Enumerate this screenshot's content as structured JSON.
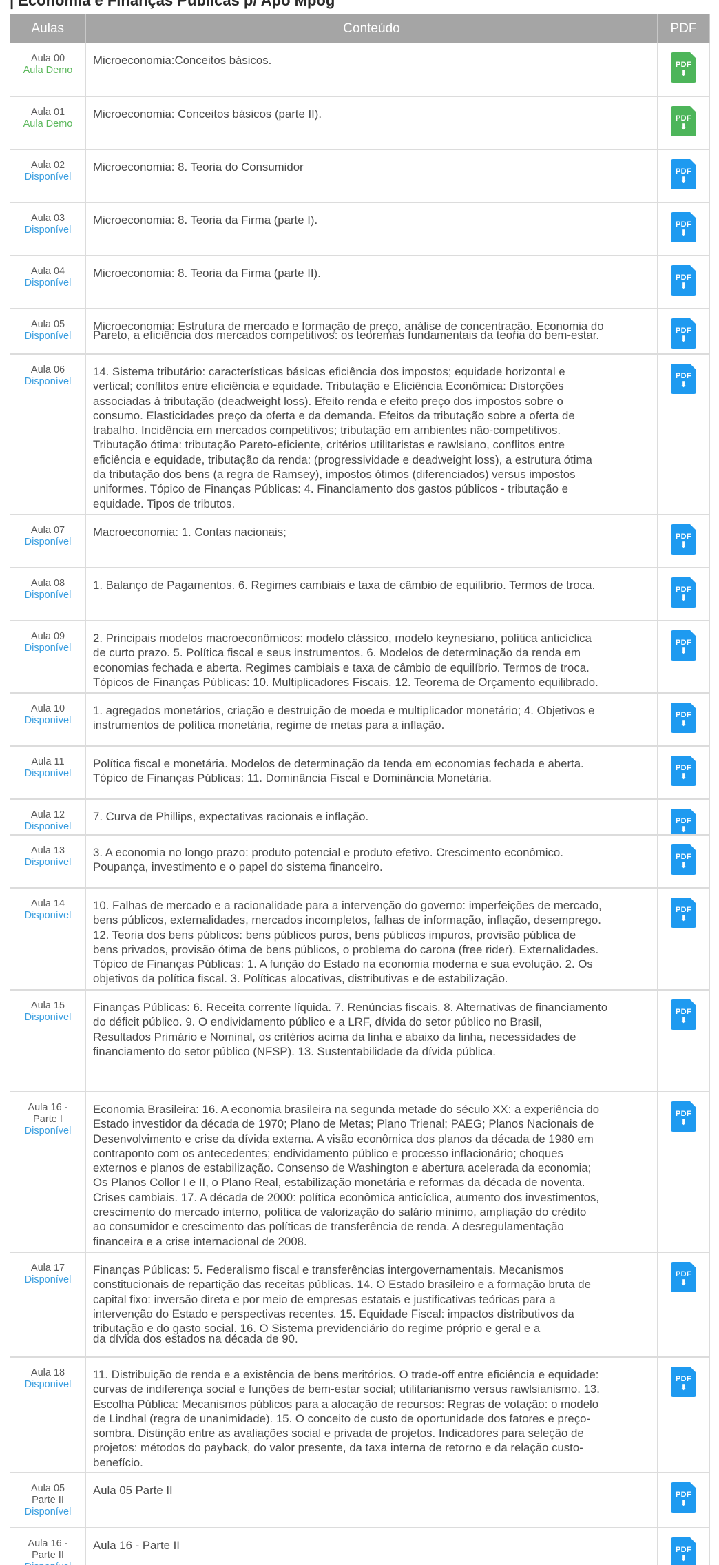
{
  "course_title": "| Economia e Finanças Públicas p/ Apo Mpog",
  "table": {
    "headers": {
      "aula": "Aulas",
      "conteudo": "Conteúdo",
      "pdf": "PDF"
    },
    "pdf_label": "PDF",
    "rows": [
      {
        "aula": "Aula 00",
        "status": "Aula Demo",
        "status_type": "demo",
        "content": [
          "Microeconomia:Conceitos básicos."
        ]
      },
      {
        "aula": "Aula 01",
        "status": "Aula Demo",
        "status_type": "demo",
        "content": [
          "Microeconomia: Conceitos básicos (parte II)."
        ]
      },
      {
        "aula": "Aula 02",
        "status": "Disponível",
        "status_type": "available",
        "content": [
          "Microeconomia: 8. Teoria do Consumidor"
        ]
      },
      {
        "aula": "Aula 03",
        "status": "Disponível",
        "status_type": "available",
        "content": [
          "Microeconomia: 8. Teoria da Firma (parte I)."
        ]
      },
      {
        "aula": "Aula 04",
        "status": "Disponível",
        "status_type": "available",
        "content": [
          "Microeconomia: 8. Teoria da Firma (parte II)."
        ]
      },
      {
        "aula": "Aula 05",
        "status": "Disponível",
        "status_type": "available",
        "content": [
          "Microeconomia: Estrutura de mercado e formação de preço, análise de concentração. Economia do",
          "Pareto, a eficiência dos mercados competitivos: os teoremas fundamentais da teoria do bem-estar."
        ]
      },
      {
        "aula": "Aula 06",
        "status": "Disponível",
        "status_type": "available",
        "content": [
          "14. Sistema tributário: características básicas eficiência dos impostos; equidade horizontal e",
          "vertical; conflitos entre eficiência e equidade. Tributação e Eficiência Econômica: Distorções",
          "associadas à tributação (deadweight loss). Efeito renda e efeito preço dos impostos sobre o",
          "consumo. Elasticidades preço da oferta e da demanda. Efeitos da tributação sobre a oferta de",
          "trabalho. Incidência em mercados competitivos; tributação em ambientes não-competitivos.",
          "Tributação ótima: tributação Pareto-eficiente, critérios utilitaristas e rawlsiano, conflitos entre",
          "eficiência e equidade, tributação da renda: (progressividade e deadweight loss), a estrutura ótima",
          "da tributação dos bens (a regra de Ramsey), impostos ótimos (diferenciados) versus impostos",
          "uniformes. Tópico de Finanças Públicas: 4. Financiamento dos gastos públicos - tributação e",
          "equidade. Tipos de tributos."
        ]
      },
      {
        "aula": "Aula 07",
        "status": "Disponível",
        "status_type": "available",
        "content": [
          "Macroeconomia: 1. Contas nacionais;"
        ]
      },
      {
        "aula": "Aula 08",
        "status": "Disponível",
        "status_type": "available",
        "content": [
          "1. Balanço de Pagamentos. 6. Regimes cambiais e taxa de câmbio de equilíbrio. Termos de troca."
        ]
      },
      {
        "aula": "Aula 09",
        "status": "Disponível",
        "status_type": "available",
        "content": [
          "2. Principais modelos macroeconômicos: modelo clássico, modelo keynesiano, política anticíclica",
          "de curto prazo. 5. Política fiscal e seus instrumentos. 6. Modelos de determinação da renda em",
          "economias fechada e aberta. Regimes cambiais e taxa de câmbio de equilíbrio. Termos de troca.",
          "Tópicos de Finanças Públicas: 10. Multiplicadores Fiscais. 12. Teorema de Orçamento equilibrado."
        ]
      },
      {
        "aula": "Aula 10",
        "status": "Disponível",
        "status_type": "available",
        "content": [
          "1. agregados monetários, criação e destruição de moeda e multiplicador monetário; 4. Objetivos e",
          "instrumentos de política monetária, regime de metas para a inflação."
        ]
      },
      {
        "aula": "Aula 11",
        "status": "Disponível",
        "status_type": "available",
        "content": [
          "Política fiscal e monetária. Modelos de determinação da tenda em economias fechada e aberta.",
          "Tópico de Finanças Públicas: 11. Dominância Fiscal e Dominância Monetária."
        ]
      },
      {
        "aula": "Aula 12",
        "status": "Disponível",
        "status_type": "available",
        "content": [
          "7. Curva de Phillips, expectativas racionais e inflação."
        ]
      },
      {
        "aula": "Aula 13",
        "status": "Disponível",
        "status_type": "available",
        "content": [
          "3. A economia no longo prazo: produto potencial e produto efetivo. Crescimento econômico.",
          "Poupança, investimento e o papel do sistema financeiro."
        ]
      },
      {
        "aula": "Aula 14",
        "status": "Disponível",
        "status_type": "available",
        "content": [
          "10. Falhas de mercado e a racionalidade para a intervenção do governo: imperfeições de mercado,",
          "bens públicos, externalidades, mercados incompletos, falhas de informação, inflação, desemprego.",
          "12. Teoria dos bens públicos: bens públicos puros, bens públicos impuros, provisão pública de",
          "bens privados, provisão ótima de bens públicos, o problema do carona (free rider). Externalidades.",
          "Tópico de Finanças Públicas: 1. A função do Estado na economia moderna e sua evolução. 2. Os",
          "objetivos da política fiscal. 3. Políticas alocativas, distributivas e de estabilização."
        ]
      },
      {
        "aula": "Aula 15",
        "status": "Disponível",
        "status_type": "available",
        "content": [
          "Finanças Públicas: 6. Receita corrente líquida. 7. Renúncias fiscais. 8. Alternativas de financiamento",
          "do déficit público. 9. O endividamento público e a LRF, dívida do setor público no Brasil,",
          "Resultados Primário e Nominal, os critérios acima da linha e abaixo da linha, necessidades de",
          "financiamento do setor público (NFSP). 13. Sustentabilidade da dívida pública."
        ]
      },
      {
        "aula": "Aula 16 -\nParte I",
        "status": "Disponível",
        "status_type": "available",
        "content": [
          "Economia Brasileira: 16. A economia brasileira na segunda metade do século XX: a experiência do",
          "Estado investidor da década de 1970; Plano de Metas; Plano Trienal; PAEG; Planos Nacionais de",
          "Desenvolvimento e crise da dívida externa. A visão econômica dos planos da década de 1980 em",
          "contraponto com os antecedentes; endividamento público e processo inflacionário; choques",
          "externos e planos de estabilização. Consenso de Washington e abertura acelerada da economia;",
          "Os Planos Collor I e II, o Plano Real, estabilização monetária e reformas da década de noventa.",
          "Crises cambiais. 17. A década de 2000: política econômica anticíclica, aumento dos investimentos,",
          "crescimento do mercado interno, política de valorização do salário mínimo, ampliação do crédito",
          "ao consumidor e crescimento das políticas de transferência de renda. A desregulamentação",
          "financeira e a crise internacional de 2008."
        ]
      },
      {
        "aula": "Aula 17",
        "status": "Disponível",
        "status_type": "available",
        "content": [
          "Finanças Públicas: 5. Federalismo fiscal e transferências intergovernamentais. Mecanismos",
          "constitucionais de repartição das receitas públicas. 14. O Estado brasileiro e a formação bruta de",
          "capital fixo: inversão direta e por meio de empresas estatais e justificativas teóricas para a",
          "intervenção do Estado e perspectivas recentes. 15. Equidade Fiscal: impactos distributivos da",
          "tributação e do gasto social. 16. O Sistema previdenciário do regime próprio e geral e a",
          "da dívida dos estados na década de 90."
        ]
      },
      {
        "aula": "Aula 18",
        "status": "Disponível",
        "status_type": "available",
        "content": [
          "11. Distribuição de renda e a existência de bens meritórios. O trade-off entre eficiência e equidade:",
          "curvas de indiferença social e funções de bem-estar social; utilitarianismo versus rawlsianismo. 13.",
          "Escolha Pública: Mecanismos públicos para a alocação de recursos: Regras de votação: o modelo",
          "de Lindhal (regra de unanimidade). 15. O conceito de custo de oportunidade dos fatores e preço-",
          "sombra. Distinção entre as avaliações social e privada de projetos. Indicadores para seleção de",
          "projetos: métodos do payback, do valor presente, da taxa interna de retorno e da relação custo-",
          "benefício."
        ]
      },
      {
        "aula": "Aula 05\nParte II",
        "status": "Disponível",
        "status_type": "available",
        "content": [
          "Aula 05 Parte II"
        ]
      },
      {
        "aula": "Aula 16 -\nParte II",
        "status": "Disponível",
        "status_type": "available",
        "content": [
          "Aula 16 - Parte II"
        ]
      }
    ]
  }
}
